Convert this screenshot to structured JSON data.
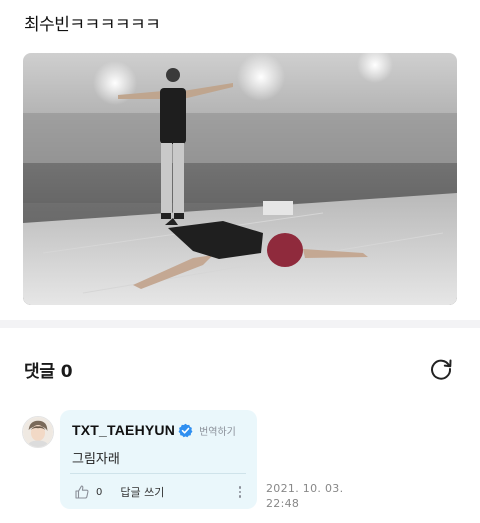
{
  "post": {
    "text": "최수빈ㅋㅋㅋㅋㅋㅋ"
  },
  "comments": {
    "title": "댓글",
    "count": "0",
    "refresh_icon": "refresh-icon"
  },
  "comment": {
    "author": "TXT_TAEHYUN",
    "verified_icon": "verified-badge-icon",
    "translate_label": "번역하기",
    "body": "그림자래",
    "like_count": "0",
    "reply_label": "답글 쓰기",
    "date_line1": "2021. 10. 03.",
    "date_line2": "22:48"
  },
  "colors": {
    "bubble_bg": "#eaf7fb",
    "verified_blue": "#2f8ff0",
    "divider": "#f3f3f5"
  }
}
